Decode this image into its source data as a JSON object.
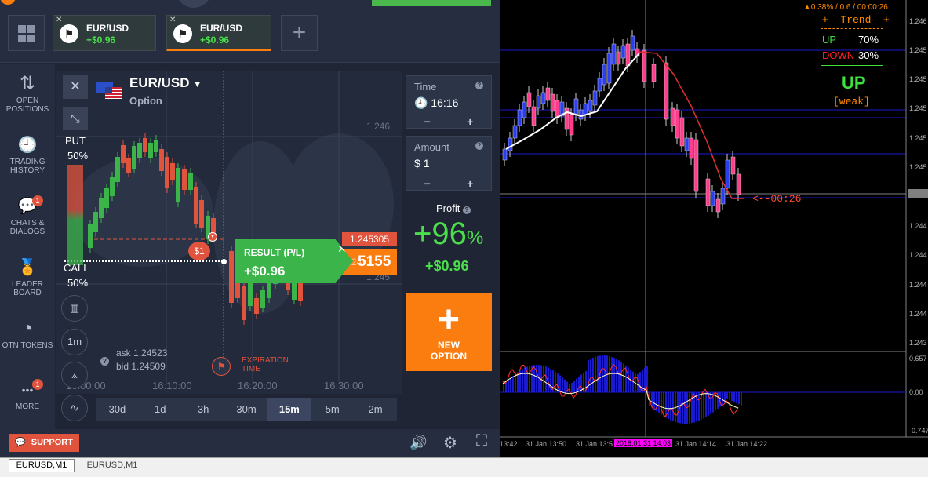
{
  "colors": {
    "accent_orange": "#fb7c0f",
    "profit_green": "#4ade4a",
    "put_red": "#e0533d",
    "call_green": "#3bb54a",
    "mt_bull": "#2b3ef0",
    "mt_bear": "#ff3d8c"
  },
  "tabs": [
    {
      "name": "EUR/USD",
      "profit": "+$0.96",
      "active": false
    },
    {
      "name": "EUR/USD",
      "profit": "+$0.96",
      "active": true
    }
  ],
  "sidebar": {
    "items": [
      {
        "icon": "open-positions-icon",
        "glyph": "⇅",
        "label": "OPEN POSITIONS"
      },
      {
        "icon": "trading-history-icon",
        "glyph": "🕘",
        "label": "TRADING HISTORY"
      },
      {
        "icon": "chats-icon",
        "glyph": "💬",
        "label": "CHATS & DIALOGS",
        "badge": "1"
      },
      {
        "icon": "leaderboard-icon",
        "glyph": "🏅",
        "label": "LEADER BOARD"
      },
      {
        "icon": "otn-tokens-icon",
        "glyph": "◔",
        "label": "OTN TOKENS"
      },
      {
        "icon": "more-icon",
        "glyph": "•••",
        "label": "MORE",
        "badge": "1"
      }
    ]
  },
  "asset": {
    "name": "EUR/USD",
    "type": "Option"
  },
  "sentiment": {
    "put_label": "PUT",
    "put_pct": "50%",
    "call_label": "CALL",
    "call_pct": "50%"
  },
  "chart": {
    "price_ticks": [
      "1.246",
      "1.245"
    ],
    "time_ticks": [
      "16:00:00",
      "16:10:00",
      "16:20:00",
      "16:30:00"
    ],
    "current_price": "1.245305",
    "current_price_big_prefix": "1.24",
    "current_price_big": "5155",
    "ask_label": "ask",
    "ask": "1.24523",
    "bid_label": "bid",
    "bid": "1.24509",
    "expiration_label": [
      "EXPIRATION",
      "TIME"
    ],
    "bet_marker": "$1",
    "result_title": "RESULT (P/L)",
    "result_value": "+$0.96",
    "chart_tools": [
      "bar-chart-icon",
      "1m",
      "draw-icon",
      "indicator-icon"
    ]
  },
  "timeframes": [
    {
      "label": "30d",
      "on": false
    },
    {
      "label": "1d",
      "on": false
    },
    {
      "label": "3h",
      "on": false
    },
    {
      "label": "30m",
      "on": false
    },
    {
      "label": "15m",
      "on": true
    },
    {
      "label": "5m",
      "on": false
    },
    {
      "label": "2m",
      "on": false
    }
  ],
  "right_panel": {
    "time_label": "Time",
    "time_value": "16:16",
    "amount_label": "Amount",
    "amount_currency": "$",
    "amount_value": "1",
    "minus": "−",
    "plus": "+",
    "profit_label": "Profit",
    "profit_pct": "+96",
    "profit_pct_sign": "%",
    "profit_value": "+$0.96",
    "new_option_label": [
      "NEW",
      "OPTION"
    ]
  },
  "bottom": {
    "support_label": "SUPPORT"
  },
  "mt": {
    "header": "▲0.38% / 0.6 / 00:00:26",
    "trend_title": "+  Trend  +",
    "up_label": "UP",
    "up_pct": "70%",
    "down_label": "DOWN",
    "down_pct": "30%",
    "signal": "UP",
    "signal_strength": "[weak]",
    "countdown": "<--00:26",
    "price_axis": [
      "1.246",
      "1.245",
      "1.245",
      "1.245",
      "1.245",
      "1.245",
      "1.244",
      "1.244",
      "1.244",
      "1.244",
      "1.243"
    ],
    "osc_axis": [
      "0.657",
      "0.00",
      "-0.747"
    ],
    "time_axis": [
      "13:42",
      "31 Jan 13:50",
      "31 Jan 13:5",
      "2018.01.31 14:03",
      "31 Jan 14:14",
      "31 Jan 14:22"
    ]
  },
  "status": {
    "tabs": [
      "EURUSD,M1",
      "EURUSD,M1"
    ]
  }
}
